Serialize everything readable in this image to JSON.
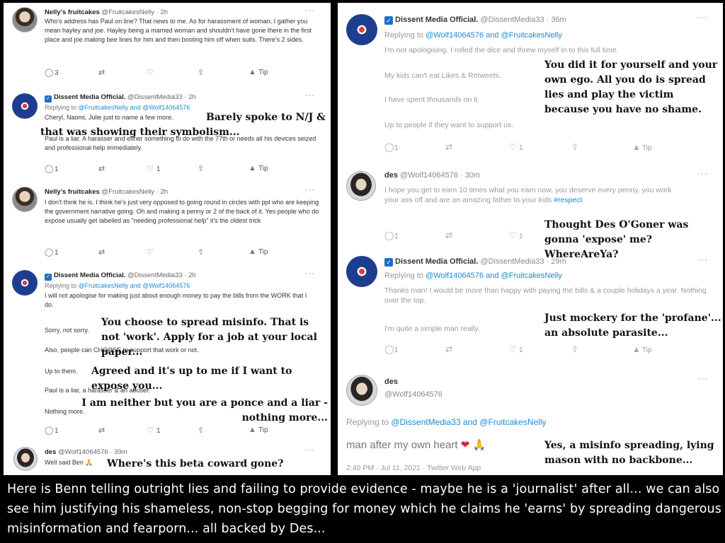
{
  "left": {
    "t1": {
      "name": "Nelly's fruitcakes",
      "handle": "@FruitcakesNelly · 2h",
      "text": "Who's address has Paul  on line? That news to me. As for harassment of woman, I gather you mean hayley and joe. Hayley being a married woman and shouldn't have gone there in the first place and joe making bee lines for him and then booting him off when suits.  There's 2 sides.",
      "replies": "3",
      "retweets": "",
      "likes": "",
      "tip": "Tip"
    },
    "t2": {
      "name": "Dissent Media Official.",
      "handle": "@DissentMedia33 · 2h",
      "replying_prefix": "Replying to",
      "replying_mentions": "@FruitcakesNelly and @Wolf14064576",
      "text_line1": "Cheryl, Naomi, Julie just to name a few more.",
      "text_line2": "Paul is a liar. A harasser and either something to do with the 77th or needs all his devices seized and professional help immediately.",
      "replies": "1",
      "likes": "1",
      "tip": "Tip",
      "note": "Barely spoke to N/J & that was showing their symbolism..."
    },
    "t3": {
      "name": "Nelly's fruitcakes",
      "handle": "@FruitcakesNelly · 2h",
      "text": "I don't think he is. I think he's just very opposed to going round in circles with ppl who are keeping the government narrative going. Oh and making a penny or 2 of the back of it. Yes people who do expose usually get labelled as \"needing professional help\" it's the oldest trick",
      "replies": "1",
      "tip": "Tip"
    },
    "t4": {
      "name": "Dissent Media Official.",
      "handle": "@DissentMedia33 · 2h",
      "replying_prefix": "Replying to",
      "replying_mentions": "@FruitcakesNelly and @Wolf14064576",
      "text1": "I will not apologise for making just about enough money to pay the bills from the WORK that I do.",
      "text2": "Sorry, not sorry.",
      "text3": "Also, people can CHOOSE to support that work or not.",
      "text4": "Up to them.",
      "text5": "Paul is a liar, a harasser & an abuser.",
      "text6": "Nothing more.",
      "replies": "1",
      "likes": "1",
      "tip": "Tip",
      "note1": "You choose to spread misinfo. That is not 'work'. Apply for a job at your local paper...",
      "note2": "Agreed and it's up to me if I want to expose you...",
      "note3": "I am neither but you are a ponce and a liar - nothing more..."
    },
    "t5": {
      "name": "des",
      "handle": "@Wolf14064576 · 39m",
      "text": "Well said Ben 🙏",
      "note": "Where's this beta coward gone?"
    }
  },
  "right": {
    "t1": {
      "name": "Dissent Media Official.",
      "handle": "@DissentMedia33 · 36m",
      "replying_prefix": "Replying to",
      "replying_mentions": "@Wolf14064576 and @FruitcakesNelly",
      "text1": "I'm not apologising. I rolled the dice and threw myself in to this full time.",
      "text2": "My kids can't eat Likes & Retweets.",
      "text3": "I have spent thousands on it.",
      "text4": "Up to people if they want to support us.",
      "replies": "1",
      "likes": "1",
      "tip": "Tip",
      "note": "You did it for yourself and your own ego. All you do is spread lies and play the victim because you have no shame."
    },
    "t2": {
      "name": "des",
      "handle": "@Wolf14064576 · 30m",
      "text": "I hope you get to earn 10 times what you earn now, you deserve every penny, you work your ass off and are an amazing father to your kids",
      "hashtag": "#respect",
      "replies": "1",
      "likes": "1",
      "note": "Thought Des O'Goner was gonna 'expose' me? WhereAreYa?"
    },
    "t3": {
      "name": "Dissent Media Official.",
      "handle": "@DissentMedia33 · 29m",
      "replying_prefix": "Replying to",
      "replying_mentions": "@Wolf14064576 and @FruitcakesNelly",
      "text1": "Thanks man! I would be more than happy with paying the bills & a couple holidays a year. Nothing over the top.",
      "text2": "I'm quite a simple man really.",
      "replies": "1",
      "likes": "1",
      "tip": "Tip",
      "note": "Just mockery for the 'profane'... an absolute parasite..."
    },
    "t4": {
      "name": "des",
      "handle": "@Wolf14064576",
      "replying_prefix": "Replying to",
      "replying_mentions": "@DissentMedia33 and @FruitcakesNelly",
      "text": "man after my own heart",
      "meta": "2:40 PM · Jul 11, 2021 · Twitter Web App",
      "note": "Yes, a misinfo spreading, lying mason with no backbone..."
    }
  },
  "caption": "Here is Benn telling outright lies and failing to provide evidence - maybe he is a 'journalist' after all... we can also see him justifying his shameless, non-stop begging for money which he claims he 'earns' by spreading dangerous misinformation and fearporn... all backed by Des...",
  "icons": {
    "reply": "reply-icon",
    "retweet": "retweet-icon",
    "like": "heart-icon",
    "share": "share-icon",
    "tip": "tip-icon",
    "more": "more-icon",
    "verified": "verified-icon"
  },
  "colors": {
    "mention": "#1d8ad8",
    "heart": "#d9252f",
    "background": "#000000",
    "panel": "#ffffff"
  }
}
